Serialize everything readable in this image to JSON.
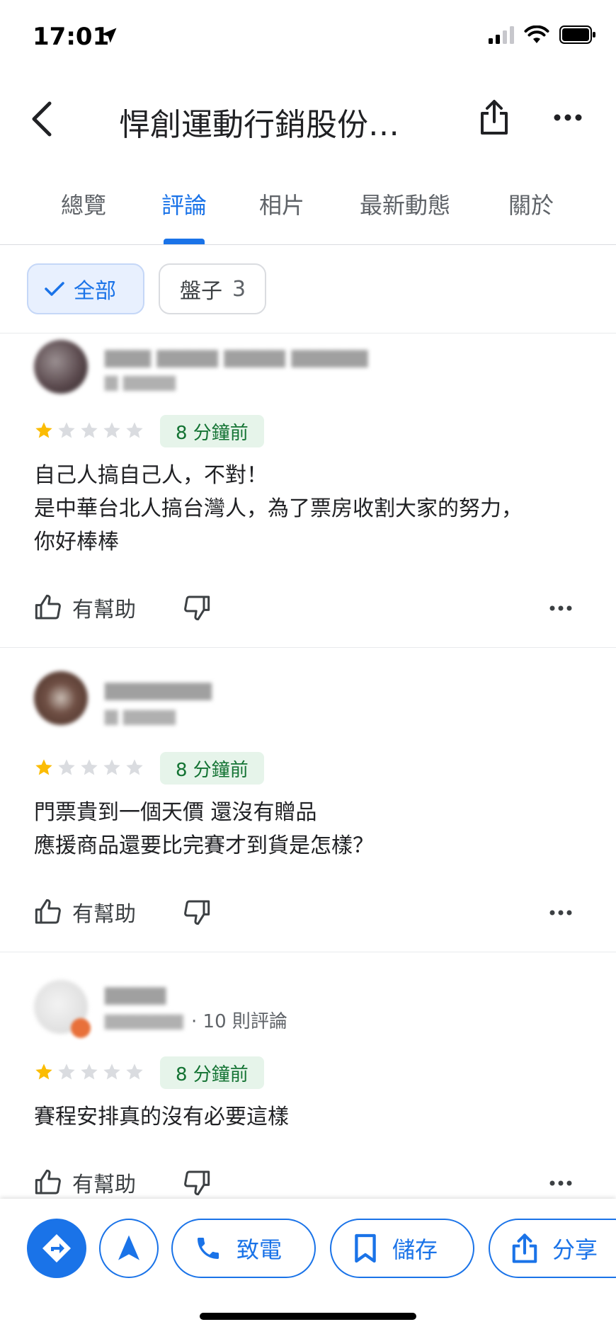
{
  "status": {
    "time": "17:01"
  },
  "header": {
    "title": "悍創運動行銷股份…"
  },
  "tabs": [
    {
      "label": "總覽"
    },
    {
      "label": "評論"
    },
    {
      "label": "相片"
    },
    {
      "label": "最新動態"
    },
    {
      "label": "關於"
    }
  ],
  "active_tab": "評論",
  "filters": {
    "all_label": "全部",
    "plate_label": "盤子",
    "plate_count": "3"
  },
  "reviews": [
    {
      "rating": 1,
      "max_rating": 5,
      "time": "8 分鐘前",
      "lines": [
        "自己人搞自己人，不對！",
        "是中華台北人搞台灣人，為了票房收割大家的努力，",
        "你好棒棒"
      ],
      "helpful_label": "有幫助"
    },
    {
      "rating": 1,
      "max_rating": 5,
      "time": "8 分鐘前",
      "lines": [
        "門票貴到一個天價 還沒有贈品",
        "應援商品還要比完賽才到貨是怎樣？"
      ],
      "helpful_label": "有幫助"
    },
    {
      "rating": 1,
      "max_rating": 5,
      "time": "8 分鐘前",
      "review_count_text": "· 10 則評論",
      "lines": [
        "賽程安排真的沒有必要這樣"
      ],
      "helpful_label": "有幫助"
    }
  ],
  "actions": {
    "call_label": "致電",
    "save_label": "儲存",
    "share_label": "分享"
  },
  "colors": {
    "accent": "#1a73e8",
    "star_filled": "#fbbc04",
    "star_empty": "#dadce0",
    "badge_bg": "#e6f4ea",
    "badge_text": "#137333"
  }
}
